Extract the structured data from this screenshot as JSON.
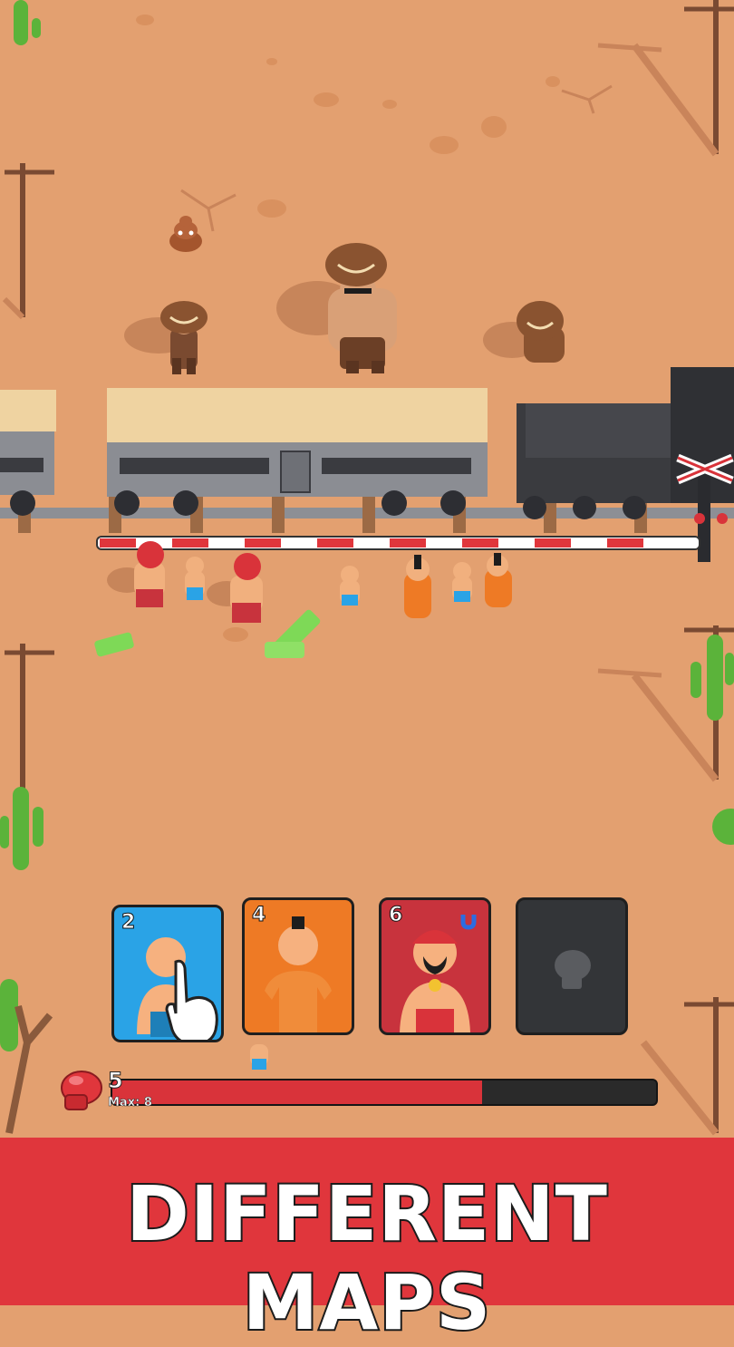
{
  "hud": {
    "cards": [
      {
        "cost": "2",
        "name": "Kid Fighter",
        "icon": "blue-fighter-card",
        "color": "#2aa3e6"
      },
      {
        "cost": "4",
        "name": "Prisoner",
        "icon": "orange-prisoner-card",
        "color": "#ee7a25"
      },
      {
        "cost": "6",
        "name": "Boxer",
        "icon": "red-boxer-card",
        "color": "#c8333d"
      },
      {
        "cost": "",
        "name": "Locked",
        "icon": "locked-glove-card",
        "color": "#333538"
      }
    ],
    "elixir": {
      "value": "5",
      "max_label": "Max: 8",
      "fill_fraction": 0.68,
      "icon": "boxing-glove-icon",
      "color": "#d9333a"
    }
  },
  "banner": {
    "title": "DIFFERENT MAPS",
    "color": "#e0363c"
  }
}
